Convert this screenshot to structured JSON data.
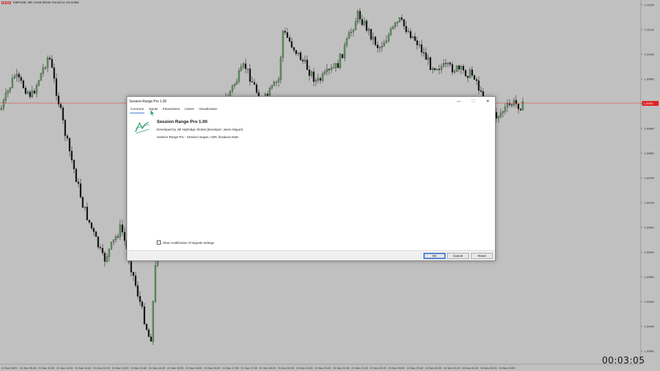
{
  "chart": {
    "symbol": "GBPUSD, M5:  Great Britain Pound vs US Dollar",
    "price_line": "1.30951",
    "price_axis_labels": [
      "1.31250",
      "1.31130",
      "1.31050",
      "1.30990",
      "1.30950",
      "1.30890",
      "1.30850",
      "1.30790",
      "1.30730",
      "1.30690",
      "1.30630",
      "1.30590",
      "1.30530",
      "1.30490",
      "1.30450"
    ],
    "time_axis_labels": [
      "21 Nov 2025",
      "21 Nov 09:45",
      "21 Nov 10:20",
      "21 Nov 11:00",
      "21 Nov 11:40",
      "21 Nov 12:20",
      "21 Nov 13:00",
      "21 Nov 13:40",
      "21 Nov 14:20",
      "21 Nov 15:00",
      "21 Nov 15:40",
      "21 Nov 16:20",
      "21 Nov 17:00",
      "21 Nov 17:40",
      "21 Nov 18:20",
      "21 Nov 19:00",
      "21 Nov 19:40",
      "21 Nov 20:20",
      "21 Nov 21:00",
      "21 Nov 21:40",
      "21 Nov 22:20",
      "21 Nov 23:00",
      "21 Nov 23:40",
      "24 Nov 00:20",
      "24 Nov 01:00",
      "24 Nov 01:40",
      "24 Nov 02:20",
      "24 Nov 03:00"
    ],
    "timer": "00:03:05",
    "colors": {
      "background": "#c0c0c0",
      "bull": "#5aa25a",
      "bear": "#111111",
      "price_line": "#e02020"
    }
  },
  "dialog": {
    "title": "Session Range Pro 1.00",
    "tabs": [
      "Common",
      "Inputs",
      "Parameters",
      "Colors",
      "Visualization"
    ],
    "active_tab": "Common",
    "product_name": "Session Range Pro 1.00",
    "developer": "Developed by JM Highridge Global (developer: Jason Miguel)",
    "description": "Session Range Pro - Session ranges, ADR, breakout stats",
    "allow_signals_label": "Allow modification of Signals settings",
    "allow_signals_checked": false,
    "buttons": {
      "ok": "OK",
      "cancel": "Cancel",
      "reset": "Reset"
    },
    "window_controls": {
      "minimize": "—",
      "maximize": "☐",
      "close": "✕"
    }
  }
}
